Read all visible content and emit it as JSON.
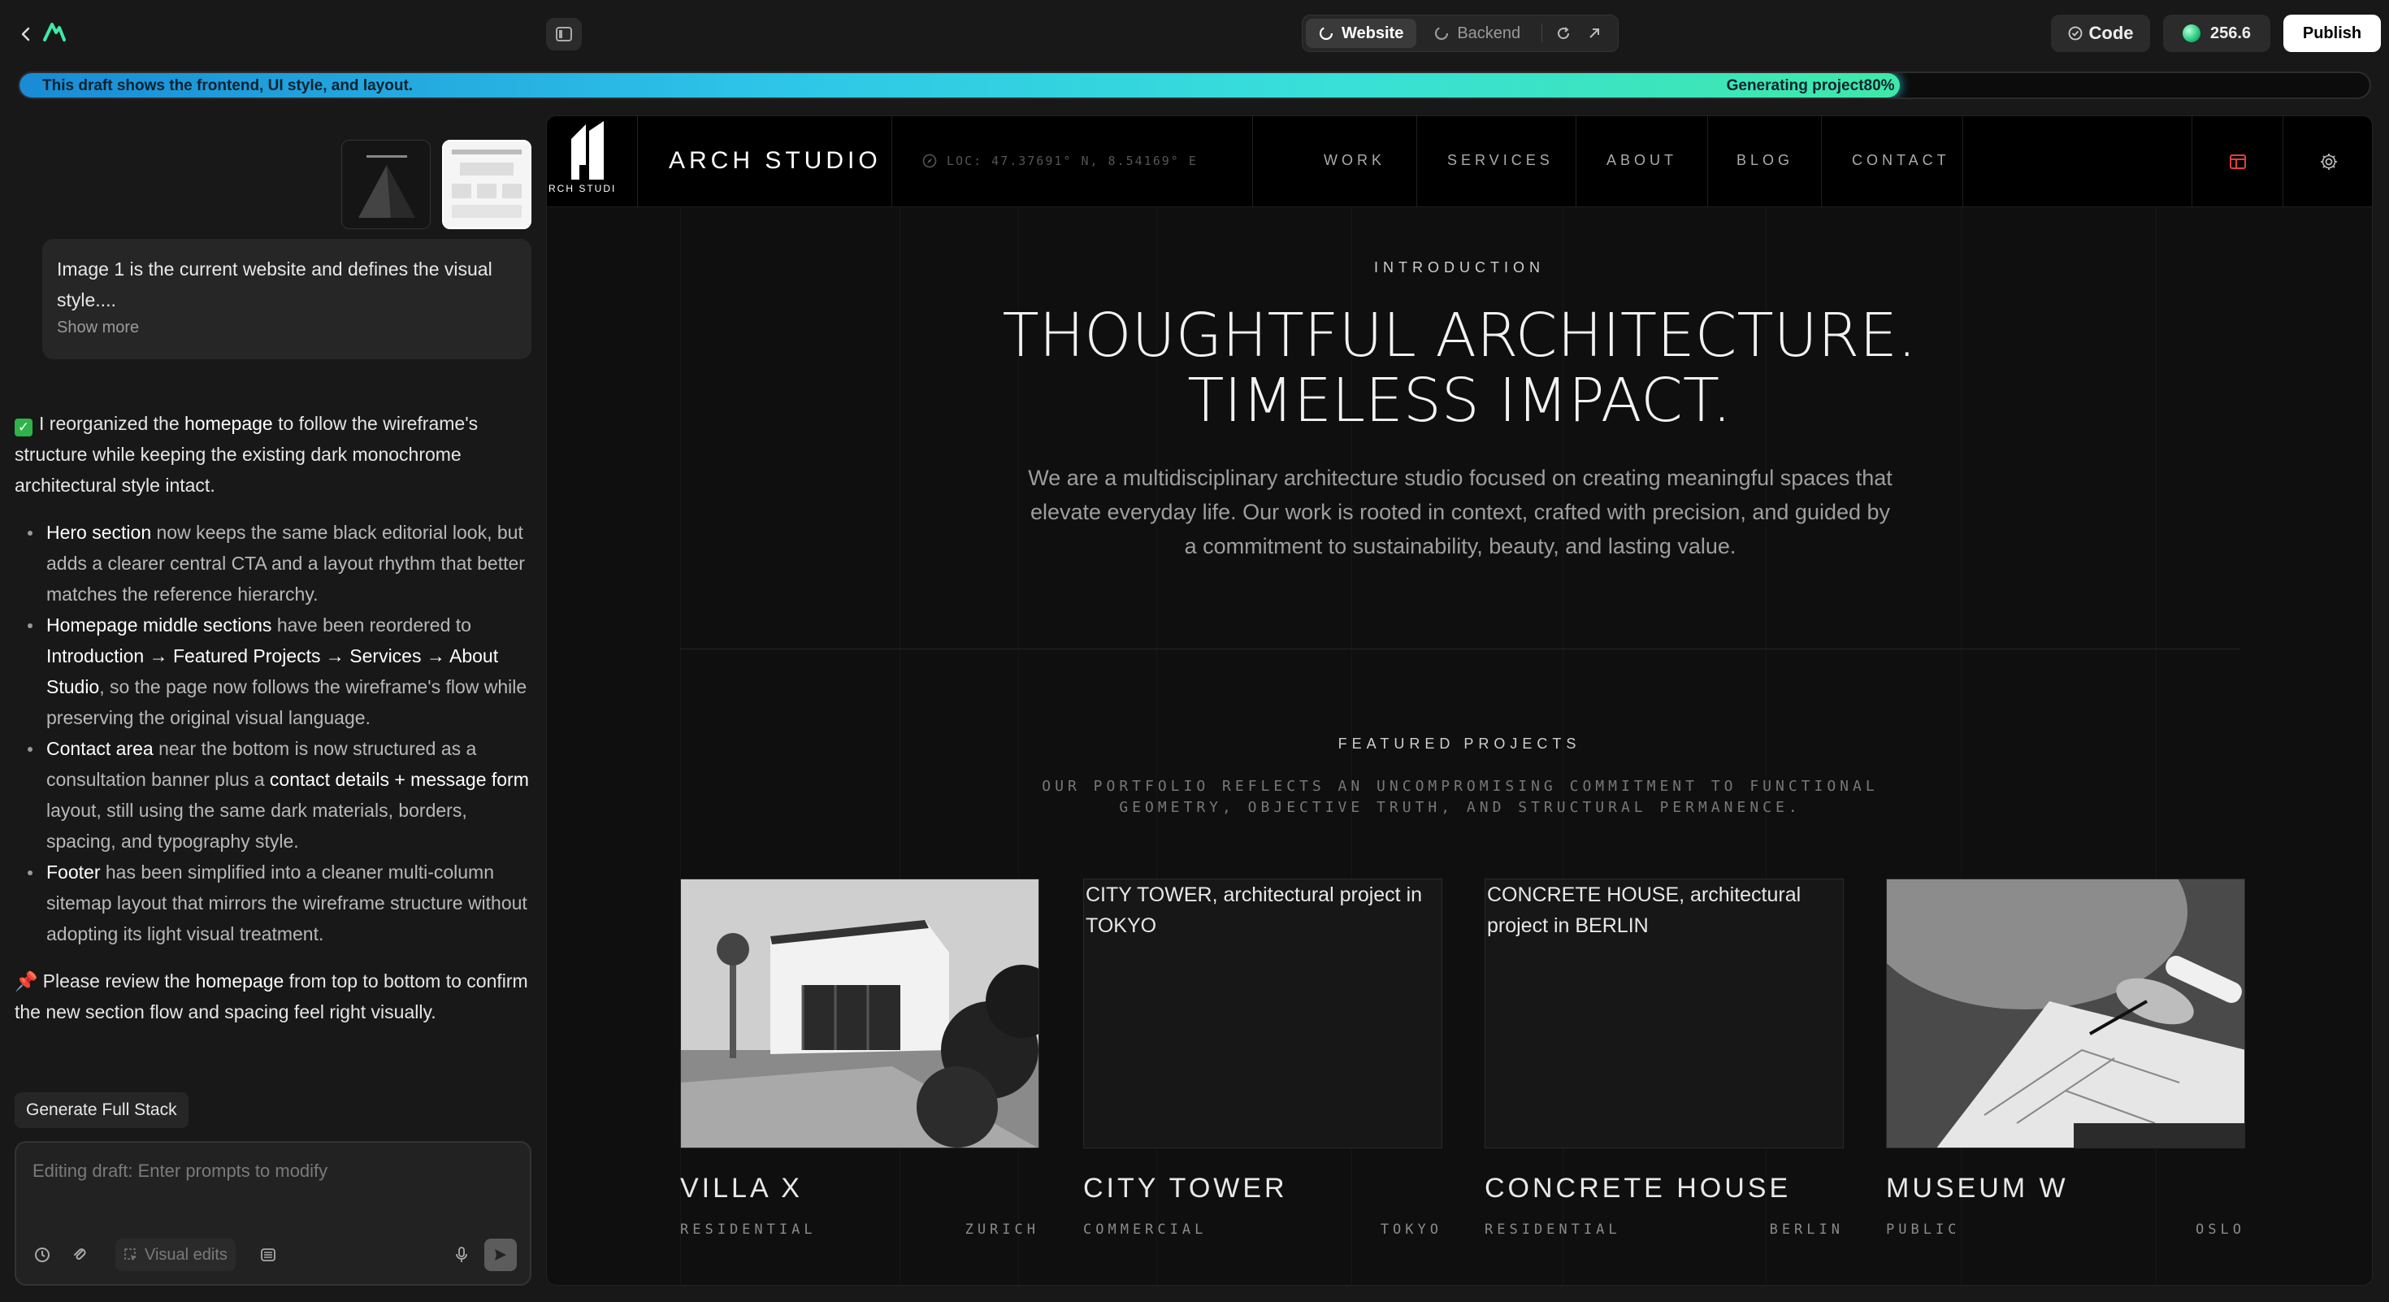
{
  "topbar": {
    "segments": [
      {
        "label": "Website",
        "active": true
      },
      {
        "label": "Backend",
        "active": false
      }
    ],
    "code_label": "Code",
    "credits": "256.6",
    "publish_label": "Publish"
  },
  "progress": {
    "message": "This draft shows the frontend, UI style, and layout.",
    "label": "Generating project80%",
    "percent": 80
  },
  "chat": {
    "user_message": "Image 1 is the current website and defines the visual style....",
    "show_more": "Show more",
    "intro_pre": "I reorganized the ",
    "intro_bold": "homepage",
    "intro_post": " to follow the wireframe's structure while keeping the existing dark monochrome architectural style intact.",
    "bullets": [
      {
        "bold": "Hero section",
        "text": " now keeps the same black editorial look, but adds a clearer central CTA and a layout rhythm that better matches the reference hierarchy."
      },
      {
        "bold": "Homepage middle sections",
        "text": " have been reordered to "
      },
      {
        "bold": "Contact area",
        "text": " near the bottom is now structured as a consultation banner plus a "
      },
      {
        "bold": "Footer",
        "text": " has been simplified into a cleaner multi-column sitemap layout that mirrors the wireframe structure without adopting its light visual treatment."
      }
    ],
    "bullet2_bold2": "Introduction → Featured Projects → Services → About Studio",
    "bullet2_tail": ", so the page now follows the wireframe's flow while preserving the original visual language.",
    "bullet3_bold2": "contact details + message form",
    "bullet3_tail": " layout, still using the same dark materials, borders, spacing, and typography style.",
    "review_pre": "Please review the ",
    "review_bold": "homepage",
    "review_post": " from top to bottom to confirm the new section flow and spacing feel right visually.",
    "generate_chip": "Generate Full Stack",
    "composer_placeholder": "Editing draft: Enter prompts to modify",
    "visual_edits": "Visual edits"
  },
  "site": {
    "logo_text": "RCH STUDI",
    "brand": "ARCH STUDIO",
    "location": "LOC: 47.37691° N, 8.54169° E",
    "nav": [
      "WORK",
      "SERVICES",
      "ABOUT",
      "BLOG",
      "CONTACT"
    ],
    "intro_eyebrow": "INTRODUCTION",
    "hero_line1": "THOUGHTFUL ARCHITECTURE.",
    "hero_line2": "TIMELESS IMPACT.",
    "hero_body": "We are a multidisciplinary architecture studio focused on creating meaningful spaces that elevate everyday life. Our work is rooted in context, crafted with precision, and guided by a commitment to sustainability, beauty, and lasting value.",
    "fp_eyebrow": "FEATURED PROJECTS",
    "fp_sub": "OUR PORTFOLIO REFLECTS AN UNCOMPROMISING COMMITMENT TO FUNCTIONAL GEOMETRY, OBJECTIVE TRUTH, AND STRUCTURAL PERMANENCE.",
    "projects": [
      {
        "name": "VILLA X",
        "category": "RESIDENTIAL",
        "city": "ZURICH",
        "alt": ""
      },
      {
        "name": "CITY TOWER",
        "category": "COMMERCIAL",
        "city": "TOKYO",
        "alt": "CITY TOWER, architectural project in TOKYO"
      },
      {
        "name": "CONCRETE HOUSE",
        "category": "RESIDENTIAL",
        "city": "BERLIN",
        "alt": "CONCRETE HOUSE, architectural project in BERLIN"
      },
      {
        "name": "MUSEUM W",
        "category": "PUBLIC",
        "city": "OSLO",
        "alt": ""
      }
    ]
  },
  "colors": {
    "background": "#181818",
    "preview_bg": "#0f0f0f",
    "accent_progress": "#2ec5e8",
    "brand_green": "#3fe8a8",
    "nav_icon_red": "#e0403a"
  }
}
